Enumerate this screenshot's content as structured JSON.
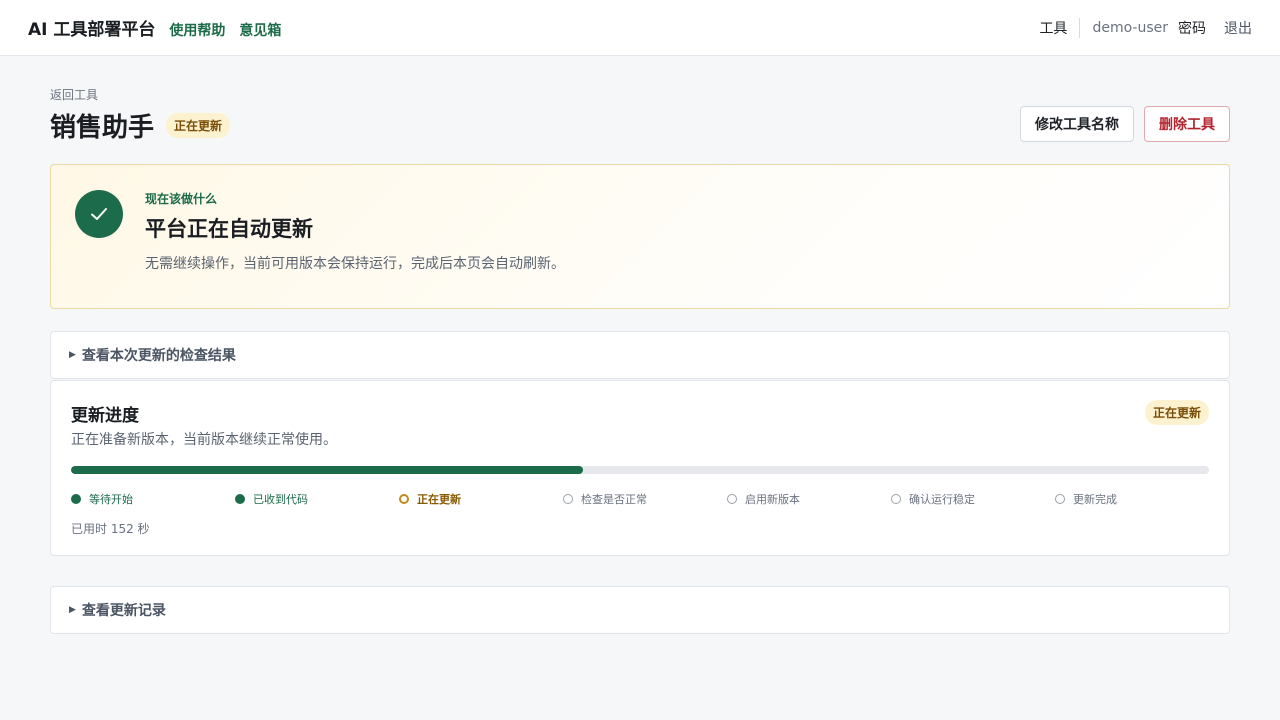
{
  "header": {
    "brand": "AI 工具部署平台",
    "nav": [
      "使用帮助",
      "意见箱"
    ],
    "tools": "工具",
    "user": "demo-user",
    "password": "密码",
    "logout": "退出"
  },
  "page": {
    "back": "返回工具",
    "title": "销售助手",
    "status_badge": "正在更新",
    "rename_button": "修改工具名称",
    "delete_button": "删除工具"
  },
  "notice": {
    "eyebrow": "现在该做什么",
    "title": "平台正在自动更新",
    "description": "无需继续操作，当前可用版本会保持运行，完成后本页会自动刷新。"
  },
  "checks_toggle": "查看本次更新的检查结果",
  "progress": {
    "title": "更新进度",
    "description": "正在准备新版本，当前版本继续正常使用。",
    "badge": "正在更新",
    "percent": 45,
    "steps": [
      {
        "label": "等待开始",
        "state": "done"
      },
      {
        "label": "已收到代码",
        "state": "done"
      },
      {
        "label": "正在更新",
        "state": "active"
      },
      {
        "label": "检查是否正常",
        "state": "todo"
      },
      {
        "label": "启用新版本",
        "state": "todo"
      },
      {
        "label": "确认运行稳定",
        "state": "todo"
      },
      {
        "label": "更新完成",
        "state": "todo"
      }
    ],
    "elapsed": "已用时 152 秒"
  },
  "history_toggle": "查看更新记录",
  "colors": {
    "brand_green": "#1c6b4a",
    "active_amber": "#c08a1d",
    "danger_red": "#b42330"
  }
}
